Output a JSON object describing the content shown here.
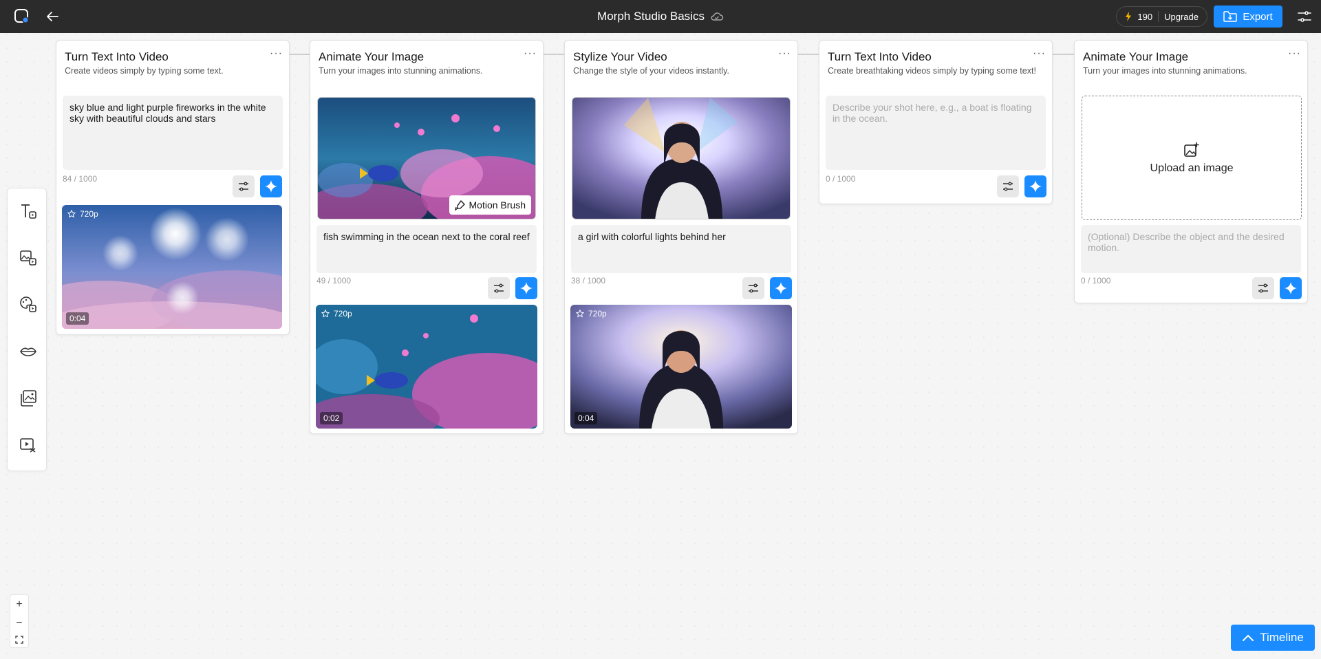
{
  "header": {
    "project_title": "Morph Studio Basics",
    "credits": "190",
    "upgrade_label": "Upgrade",
    "export_label": "Export"
  },
  "cards": [
    {
      "title": "Turn Text Into Video",
      "subtitle": "Create videos simply by typing some text.",
      "prompt": "sky blue and light purple fireworks in the white sky with beautiful clouds and stars",
      "char_count": "84 / 1000",
      "output": {
        "resolution": "720p",
        "duration": "0:04"
      }
    },
    {
      "title": "Animate Your Image",
      "subtitle": "Turn your images into stunning animations.",
      "motion_brush_label": "Motion Brush",
      "prompt": "fish swimming in the ocean next to the coral reef",
      "char_count": "49 / 1000",
      "output": {
        "resolution": "720p",
        "duration": "0:02"
      }
    },
    {
      "title": "Stylize Your Video",
      "subtitle": "Change the style of your videos instantly.",
      "prompt": "a girl with colorful lights behind her",
      "char_count": "38 / 1000",
      "output": {
        "resolution": "720p",
        "duration": "0:04"
      }
    },
    {
      "title": "Turn Text Into Video",
      "subtitle": "Create breathtaking videos simply by typing some text!",
      "prompt_placeholder": "Describe your shot here, e.g., a boat is floating in the ocean.",
      "char_count": "0 / 1000"
    },
    {
      "title": "Animate Your Image",
      "subtitle": "Turn your images into stunning animations.",
      "upload_label": "Upload an image",
      "prompt_placeholder": "(Optional) Describe the object and the desired motion.",
      "char_count": "0 / 1000"
    }
  ],
  "timeline_label": "Timeline",
  "colors": {
    "accent": "#1a8cff",
    "topbar": "#2b2b2b",
    "canvas": "#f5f5f5"
  }
}
